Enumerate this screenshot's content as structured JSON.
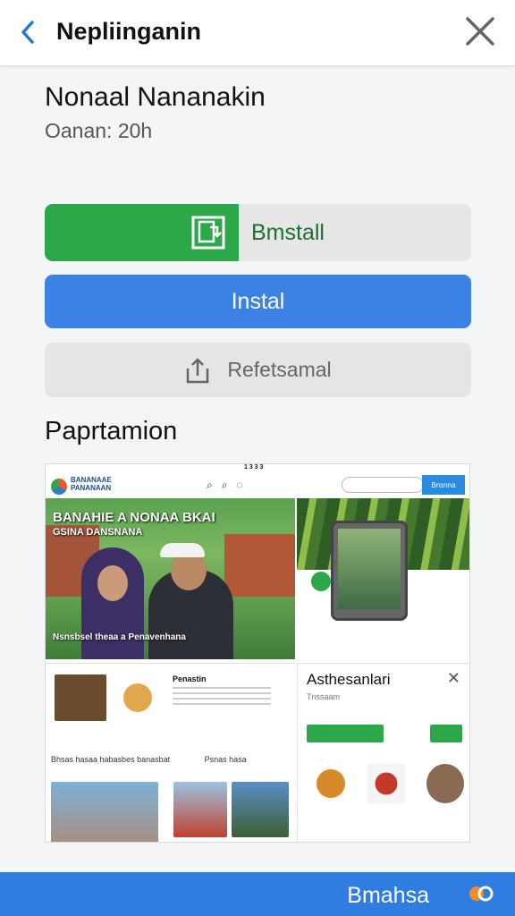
{
  "topbar": {
    "title": "Nepliinganin"
  },
  "app": {
    "name": "Nonaal Nananakin",
    "meta": "Oanan: 20h"
  },
  "buttons": {
    "install_split": "Bmstall",
    "instal": "Instal",
    "restore": "Refetsamal"
  },
  "section": {
    "title": "Paprtamion"
  },
  "screenshot": {
    "status_time": "1 3 3 3",
    "brand": "BANANAAE PANANAAN",
    "headline": "BANAHIE A NONAA BKAI",
    "headline2": "GSINA DANSNANA",
    "caption": "Nsnsbsel theaa a Penavenhana",
    "right_button": "Bnsnna",
    "card_title": "Penastin",
    "row_text": "Bhsas hasaa habasbes banasbat",
    "row_right": "Psnas hasa",
    "modal_title": "Asthesanlari",
    "modal_sub": "Tnssaam"
  },
  "bottombar": {
    "label": "Bmahsa"
  },
  "colors": {
    "green": "#2ca84a",
    "blue": "#3b82e4",
    "bottom": "#2f7de0"
  }
}
